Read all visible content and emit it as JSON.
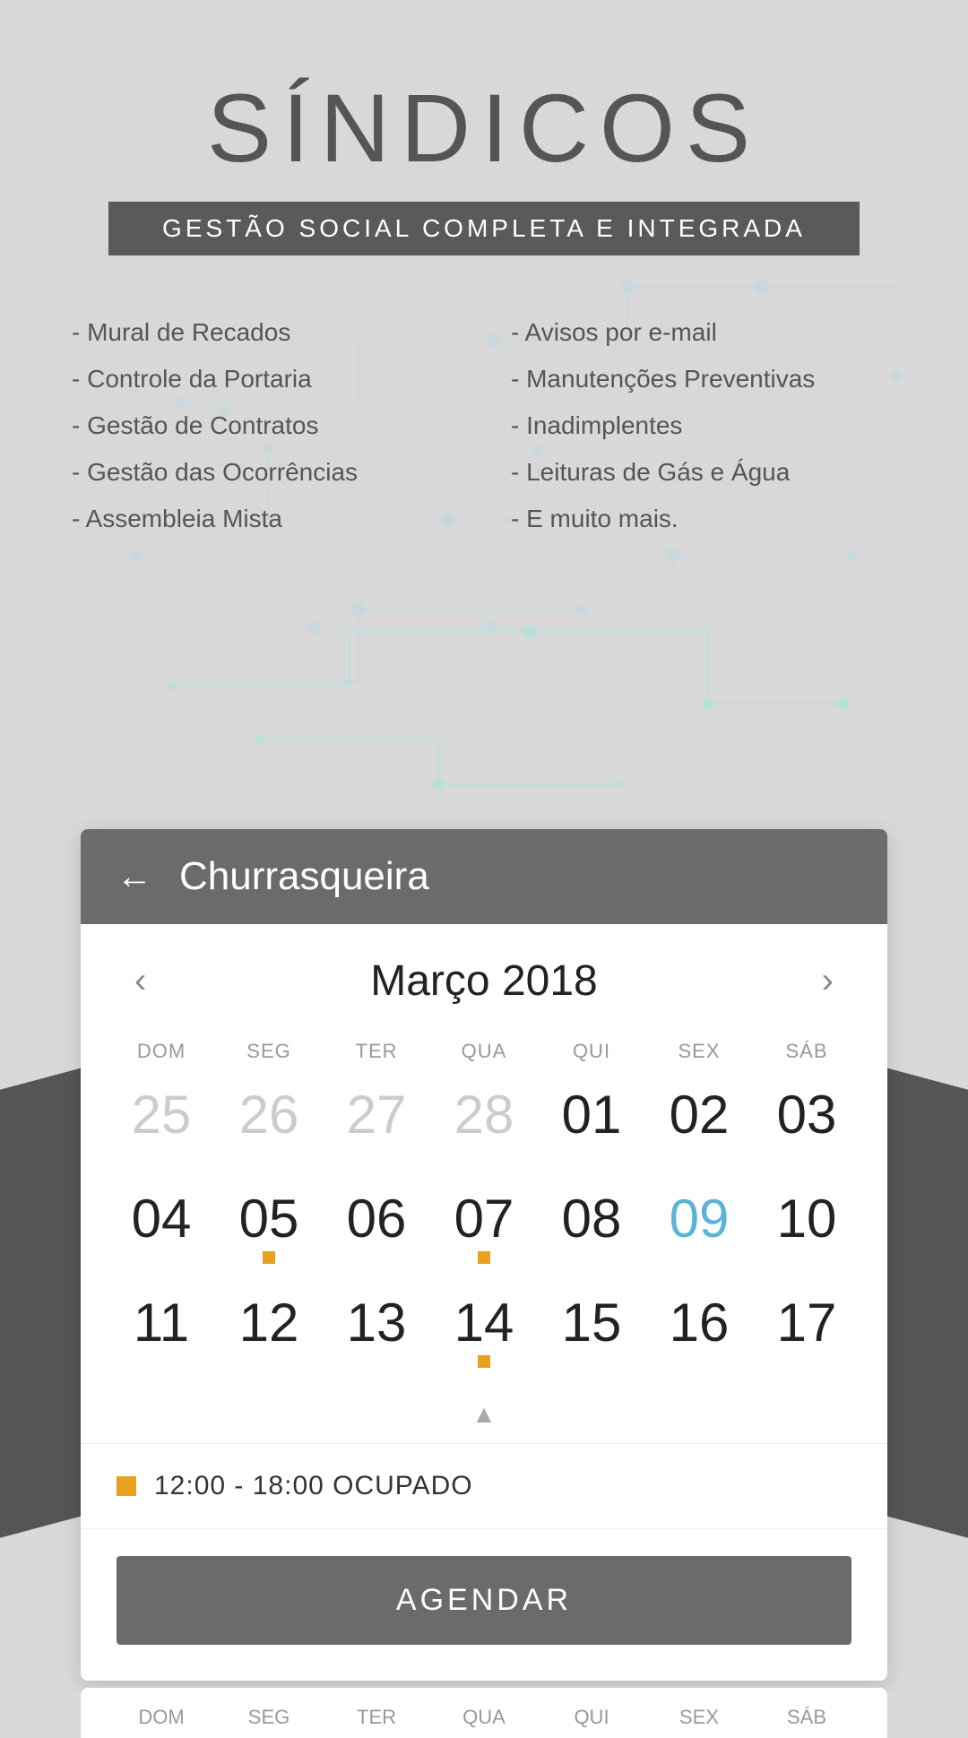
{
  "app": {
    "title": "SÍNDICOS",
    "subtitle": "GESTÃO SOCIAL COMPLETA E INTEGRADA"
  },
  "features": {
    "col1": [
      "- Mural de Recados",
      "- Controle da Portaria",
      "- Gestão de Contratos",
      "- Gestão das Ocorrências",
      "- Assembleia Mista"
    ],
    "col2": [
      "- Avisos por e-mail",
      "- Manutenções Preventivas",
      "- Inadimplentes",
      "- Leituras de Gás e Água",
      "- E muito mais."
    ]
  },
  "calendar": {
    "back_label": "←",
    "room_title": "Churrasqueira",
    "month_label": "Março 2018",
    "prev_arrow": "‹",
    "next_arrow": "›",
    "day_headers": [
      "DOM",
      "SEG",
      "TER",
      "QUA",
      "QUI",
      "SEX",
      "SÁB"
    ],
    "weeks": [
      [
        {
          "num": "25",
          "muted": true,
          "dot": false
        },
        {
          "num": "26",
          "muted": true,
          "dot": false
        },
        {
          "num": "27",
          "muted": true,
          "dot": false
        },
        {
          "num": "28",
          "muted": true,
          "dot": false
        },
        {
          "num": "01",
          "muted": false,
          "dot": false
        },
        {
          "num": "02",
          "muted": false,
          "dot": false
        },
        {
          "num": "03",
          "muted": false,
          "dot": false
        }
      ],
      [
        {
          "num": "04",
          "muted": false,
          "dot": false
        },
        {
          "num": "05",
          "muted": false,
          "dot": true
        },
        {
          "num": "06",
          "muted": false,
          "dot": false
        },
        {
          "num": "07",
          "muted": false,
          "dot": true
        },
        {
          "num": "08",
          "muted": false,
          "dot": false
        },
        {
          "num": "09",
          "muted": false,
          "dot": false,
          "today": true
        },
        {
          "num": "10",
          "muted": false,
          "dot": false
        }
      ],
      [
        {
          "num": "11",
          "muted": false,
          "dot": false
        },
        {
          "num": "12",
          "muted": false,
          "dot": false
        },
        {
          "num": "13",
          "muted": false,
          "dot": false
        },
        {
          "num": "14",
          "muted": false,
          "dot": true
        },
        {
          "num": "15",
          "muted": false,
          "dot": false
        },
        {
          "num": "16",
          "muted": false,
          "dot": false
        },
        {
          "num": "17",
          "muted": false,
          "dot": false
        }
      ]
    ],
    "booking": {
      "time": "12:00 - 18:00 OCUPADO"
    },
    "agendar_label": "AGENDAR",
    "bottom_headers": [
      "DOM",
      "SEG",
      "TER",
      "QUA",
      "QUI",
      "SEX",
      "SÁB"
    ]
  }
}
